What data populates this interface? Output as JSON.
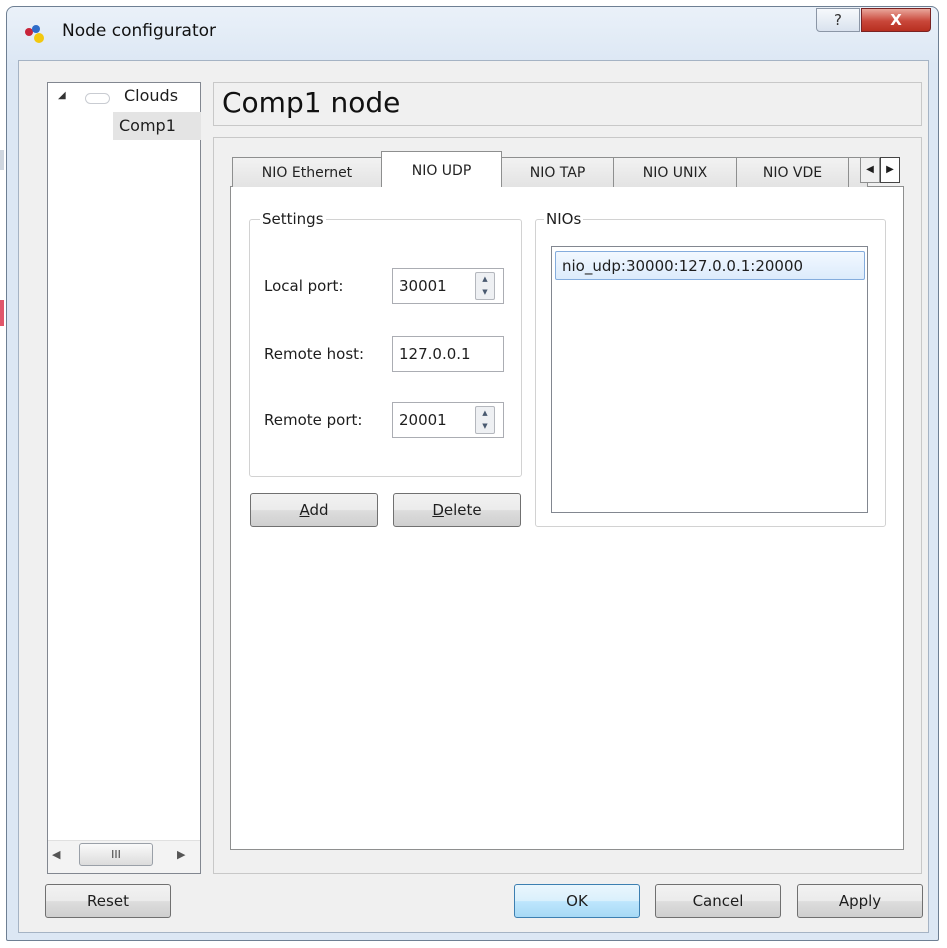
{
  "window": {
    "title": "Node configurator",
    "help_glyph": "?",
    "close_glyph": "X"
  },
  "tree": {
    "expand_glyph": "◢",
    "root_label": "Clouds",
    "child_label": "Comp1",
    "scroll_left_glyph": "◀",
    "scroll_right_glyph": "▶",
    "scroll_thumb_glyph": "III"
  },
  "header": {
    "node_title": "Comp1 node"
  },
  "tabs": {
    "items": [
      "NIO Ethernet",
      "NIO UDP",
      "NIO TAP",
      "NIO UNIX",
      "NIO VDE"
    ],
    "active": "NIO UDP",
    "scroll_left_glyph": "◀",
    "scroll_right_glyph": "▶"
  },
  "settings": {
    "group_title": "Settings",
    "local_port_label": "Local port:",
    "local_port_value": "30001",
    "remote_host_label": "Remote host:",
    "remote_host_value": "127.0.0.1",
    "remote_port_label": "Remote port:",
    "remote_port_value": "20001",
    "spin_up_glyph": "▲",
    "spin_down_glyph": "▼"
  },
  "actions": {
    "add_label": "A",
    "add_rest": "dd",
    "delete_label": "D",
    "delete_rest": "elete"
  },
  "nios": {
    "group_title": "NIOs",
    "items": [
      "nio_udp:30000:127.0.0.1:20000"
    ]
  },
  "footer": {
    "reset_label": "Reset",
    "ok_label": "OK",
    "cancel_label": "Cancel",
    "apply_label": "Apply"
  },
  "colors": {
    "accent": "#3c7fb1",
    "selection": "#dcebfc",
    "close": "#c9473a"
  }
}
